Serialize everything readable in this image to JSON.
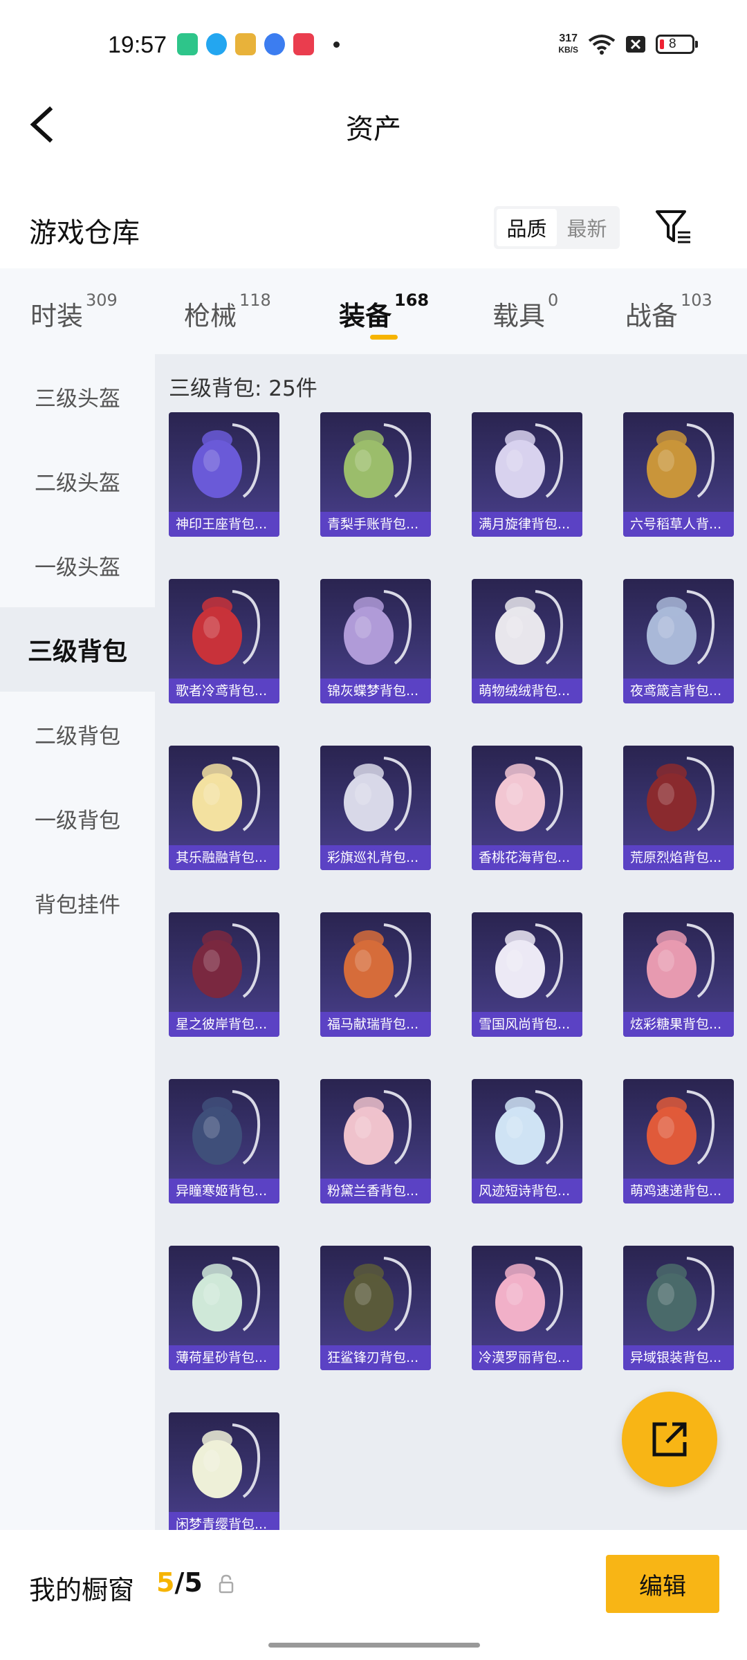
{
  "status": {
    "time": "19:57",
    "net_speed": "317",
    "net_unit": "KB/S",
    "battery": "8"
  },
  "header": {
    "title": "资产"
  },
  "warehouse": {
    "title": "游戏仓库",
    "sort_options": [
      "品质",
      "最新"
    ]
  },
  "tabs": [
    {
      "label": "时装",
      "count": "309"
    },
    {
      "label": "枪械",
      "count": "118"
    },
    {
      "label": "装备",
      "count": "168"
    },
    {
      "label": "载具",
      "count": "0"
    },
    {
      "label": "战备",
      "count": "103"
    }
  ],
  "sidebar": {
    "items": [
      "三级头盔",
      "二级头盔",
      "一级头盔",
      "三级背包",
      "二级背包",
      "一级背包",
      "背包挂件"
    ]
  },
  "content": {
    "section_title": "三级背包: 25件",
    "items": [
      "神印王座背包...",
      "青梨手账背包...",
      "满月旋律背包...",
      "六号稻草人背...",
      "歌者冷鸢背包...",
      "锦灰蝶梦背包...",
      "萌物绒绒背包...",
      "夜鸢箴言背包...",
      "其乐融融背包...",
      "彩旗巡礼背包...",
      "香桃花海背包...",
      "荒原烈焰背包...",
      "星之彼岸背包...",
      "福马献瑞背包...",
      "雪国风尚背包...",
      "炫彩糖果背包...",
      "异瞳寒姬背包...",
      "粉黛兰香背包...",
      "风迹短诗背包...",
      "萌鸡速递背包...",
      "薄荷星砂背包...",
      "狂鲨锋刃背包...",
      "冷漠罗丽背包...",
      "异域银装背包...",
      "闲梦青缨背包..."
    ],
    "item_colors": [
      "#6a5ad8",
      "#9bbd6b",
      "#d8d2ee",
      "#c9953a",
      "#c8323a",
      "#b09bd8",
      "#e8e6ec",
      "#a9b8d8",
      "#f3e1a0",
      "#d8d8e8",
      "#f2c6d2",
      "#8a2a2e",
      "#7a2840",
      "#d66c3a",
      "#ece9f5",
      "#e79ab0",
      "#3f4f7a",
      "#efc2cc",
      "#cfe3f4",
      "#e05a3a",
      "#cfe8d8",
      "#5a5a3a",
      "#f1b0c8",
      "#4a6a6a",
      "#eef0d8"
    ]
  },
  "bottom": {
    "showcase_label": "我的橱窗",
    "showcase_current": "5",
    "showcase_total": "/5",
    "edit_label": "编辑"
  },
  "colors": {
    "accent": "#f8b515",
    "card_label": "#5b42c4"
  }
}
